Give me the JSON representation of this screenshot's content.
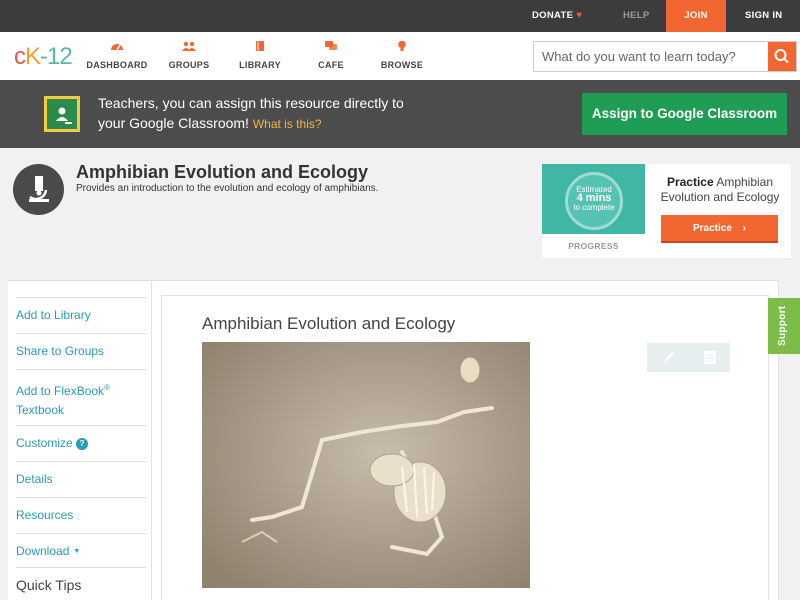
{
  "topbar": {
    "donate": "DONATE",
    "help": "HELP",
    "join": "JOIN",
    "signin": "SIGN IN"
  },
  "logo": {
    "c": "c",
    "k": "K",
    "num": "-12"
  },
  "nav": [
    {
      "label": "DASHBOARD",
      "icon": "dashboard-gauge-icon"
    },
    {
      "label": "GROUPS",
      "icon": "groups-people-icon"
    },
    {
      "label": "LIBRARY",
      "icon": "library-book-icon"
    },
    {
      "label": "CAFE",
      "icon": "cafe-chat-icon"
    },
    {
      "label": "BROWSE",
      "icon": "browse-bulb-icon"
    }
  ],
  "search": {
    "placeholder": "What do you want to learn today?",
    "icon": "search-icon"
  },
  "classroom": {
    "line1": "Teachers, you can assign this resource directly to",
    "line2": "your Google Classroom!",
    "what": "What is this?",
    "button": "Assign to Google Classroom",
    "icon": "google-classroom-icon"
  },
  "concept": {
    "title": "Amphibian Evolution and Ecology",
    "description": "Provides an introduction to the evolution and ecology of amphibians.",
    "icon": "microscope-icon"
  },
  "practice": {
    "estimated": "Estimated",
    "mins": "4 mins",
    "to_complete": "to complete",
    "progress_label": "PROGRESS",
    "label_bold": "Practice",
    "label_rest": "Amphibian Evolution and Ecology",
    "button": "Practice"
  },
  "sidebar": {
    "add_library": "Add to Library",
    "share_groups": "Share to Groups",
    "add_flexbook_1": "Add to FlexBook",
    "add_flexbook_2": "Textbook",
    "reg": "®",
    "customize": "Customize",
    "details": "Details",
    "resources": "Resources",
    "download": "Download",
    "quick_tips": "Quick Tips"
  },
  "content": {
    "title": "Amphibian Evolution and Ecology",
    "image_subject": "fossil-frog-image"
  },
  "support": "Support",
  "colors": {
    "orange": "#f26631",
    "green": "#1f9d55",
    "teal": "#40b7a5",
    "link": "#2a9bb5",
    "support": "#7cbc48"
  }
}
